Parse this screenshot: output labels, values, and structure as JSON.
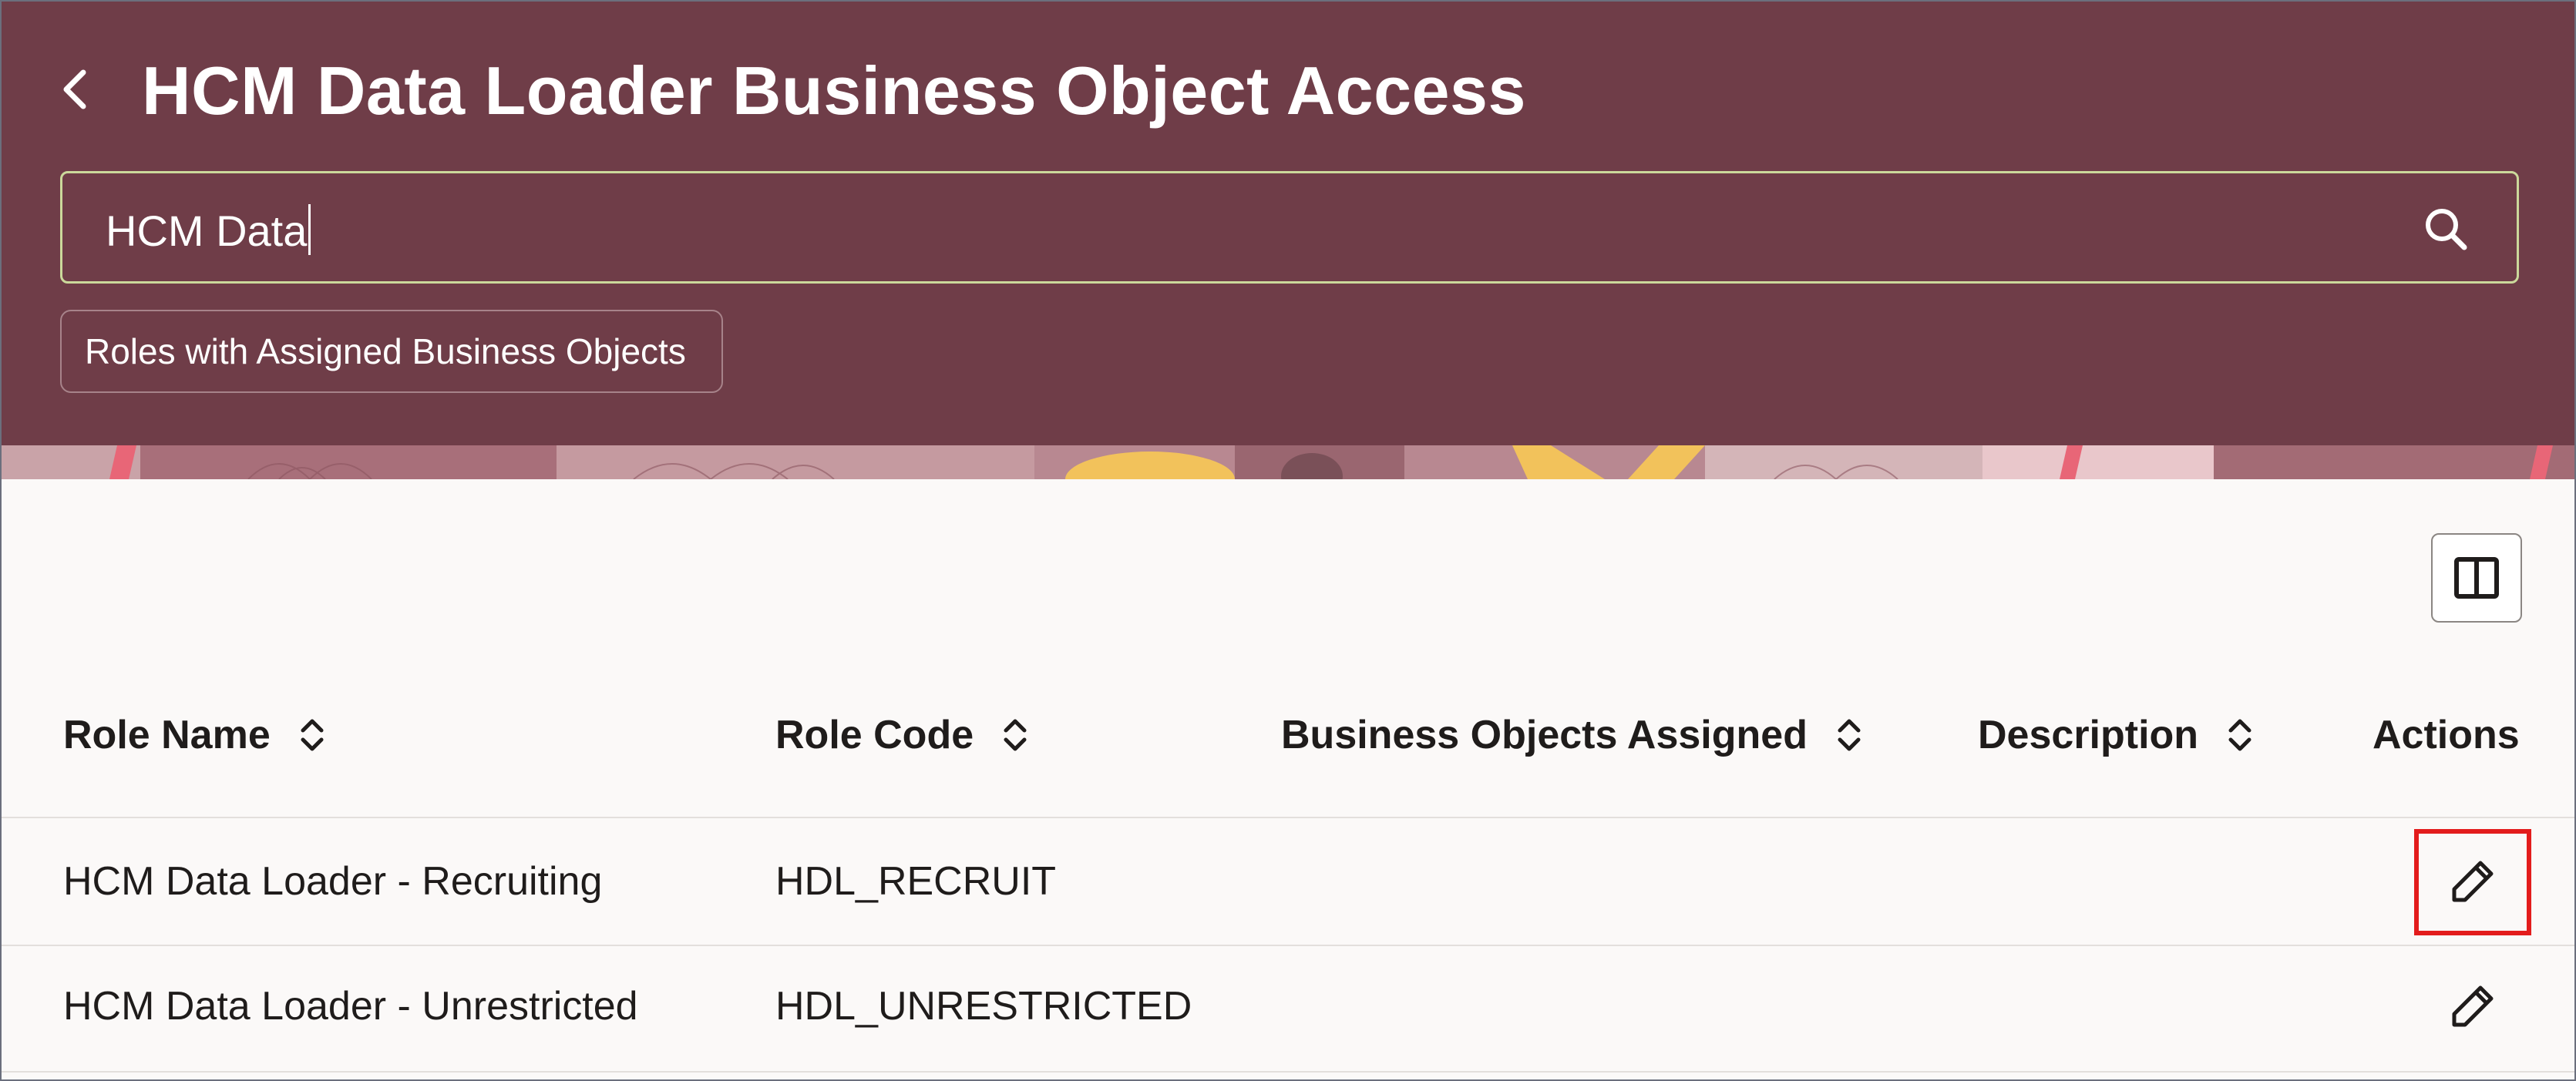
{
  "header": {
    "title": "HCM Data Loader Business Object Access",
    "back_icon": "chevron-left-icon",
    "colors": {
      "background": "#6f3d48",
      "search_border": "#cbd99b"
    }
  },
  "search": {
    "value": "HCM Data",
    "icon": "search-icon"
  },
  "filter_chip": {
    "label": "Roles with Assigned Business Objects"
  },
  "toolbar": {
    "panel_toggle_icon": "panel-columns-icon"
  },
  "table": {
    "columns": [
      {
        "label": "Role Name",
        "sortable": true
      },
      {
        "label": "Role Code",
        "sortable": true
      },
      {
        "label": "Business Objects Assigned",
        "sortable": true
      },
      {
        "label": "Description",
        "sortable": true
      },
      {
        "label": "Actions",
        "sortable": false
      }
    ],
    "rows": [
      {
        "role_name": "HCM Data Loader - Recruiting",
        "role_code": "HDL_RECRUIT",
        "business_objects_assigned": "",
        "description": "",
        "action_icon": "pencil-edit-icon",
        "highlighted": true
      },
      {
        "role_name": "HCM Data Loader - Unrestricted",
        "role_code": "HDL_UNRESTRICTED",
        "business_objects_assigned": "",
        "description": "",
        "action_icon": "pencil-edit-icon",
        "highlighted": false
      }
    ]
  },
  "annotation": {
    "highlight_color": "#e31c1c"
  }
}
